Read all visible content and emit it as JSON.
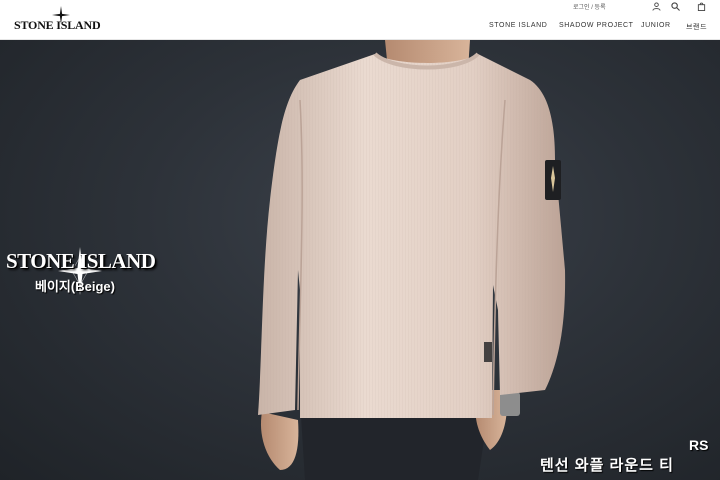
{
  "header": {
    "logo_text": "STONE ISLAND",
    "util_links": "로그인 / 등록",
    "nav": [
      "STONE ISLAND",
      "SHADOW PROJECT",
      "JUNIOR",
      "브랜드"
    ]
  },
  "hero": {
    "brand_name": "STONE ISLAND",
    "color_label": "베이지(Beige)",
    "rs_label": "RS",
    "product_title": "텐선 와플 라운드 티",
    "colors": {
      "background": "#2d3239",
      "garment": "#e4d2c8",
      "patch": "#1e1f22"
    }
  }
}
